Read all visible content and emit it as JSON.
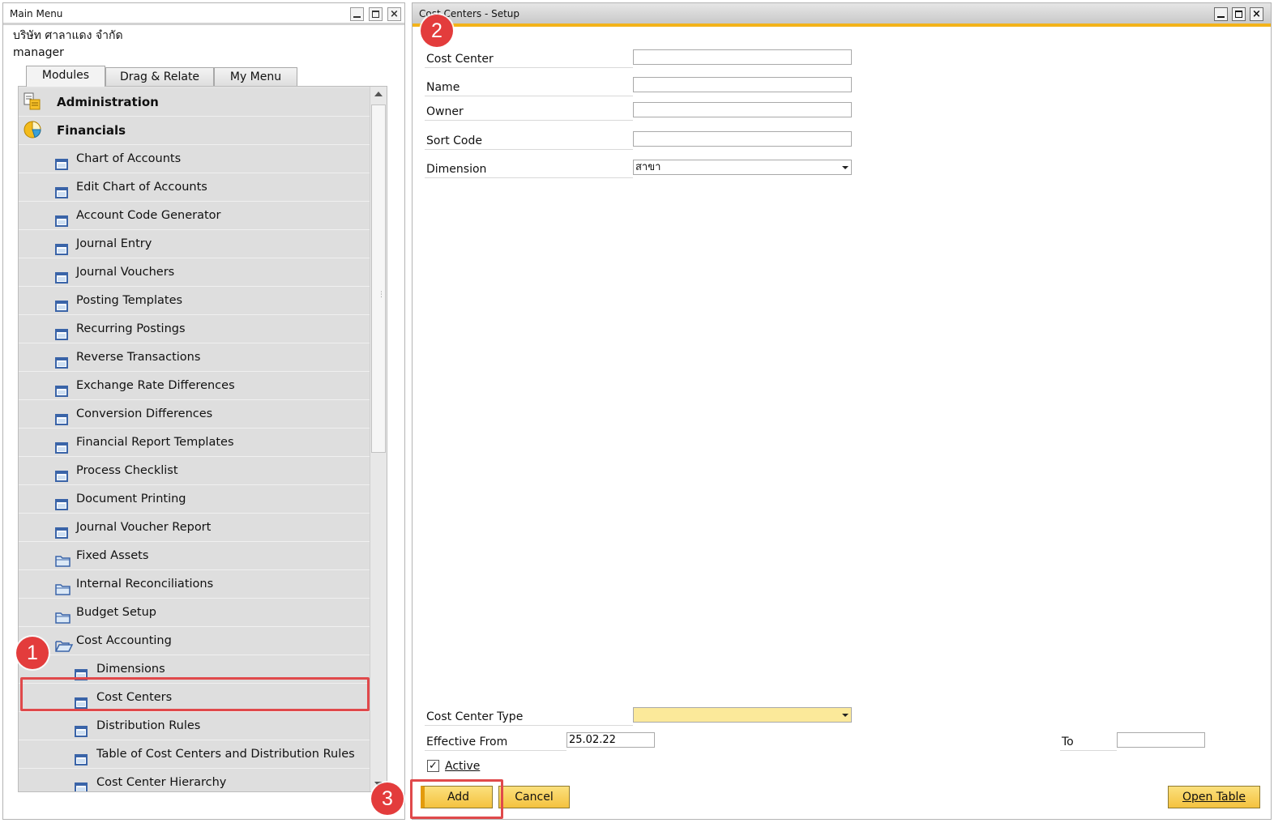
{
  "main_menu": {
    "title": "Main Menu",
    "company": "บริษัท ศาลาแดง จำกัด",
    "user": "manager",
    "tabs": [
      {
        "label": "Modules",
        "active": true
      },
      {
        "label": "Drag & Relate",
        "active": false
      },
      {
        "label": "My Menu",
        "active": false
      }
    ],
    "items": [
      {
        "label": "Administration",
        "level": 0,
        "icon": "administration-icon"
      },
      {
        "label": "Financials",
        "level": 0,
        "icon": "financials-icon"
      },
      {
        "label": "Chart of Accounts",
        "level": 1,
        "icon": "form-icon"
      },
      {
        "label": "Edit Chart of Accounts",
        "level": 1,
        "icon": "form-icon"
      },
      {
        "label": "Account Code Generator",
        "level": 1,
        "icon": "form-icon"
      },
      {
        "label": "Journal Entry",
        "level": 1,
        "icon": "form-icon"
      },
      {
        "label": "Journal Vouchers",
        "level": 1,
        "icon": "form-icon"
      },
      {
        "label": "Posting Templates",
        "level": 1,
        "icon": "form-icon"
      },
      {
        "label": "Recurring Postings",
        "level": 1,
        "icon": "form-icon"
      },
      {
        "label": "Reverse Transactions",
        "level": 1,
        "icon": "form-icon"
      },
      {
        "label": "Exchange Rate Differences",
        "level": 1,
        "icon": "form-icon"
      },
      {
        "label": "Conversion Differences",
        "level": 1,
        "icon": "form-icon"
      },
      {
        "label": "Financial Report Templates",
        "level": 1,
        "icon": "form-icon"
      },
      {
        "label": "Process Checklist",
        "level": 1,
        "icon": "form-icon"
      },
      {
        "label": "Document Printing",
        "level": 1,
        "icon": "form-icon"
      },
      {
        "label": "Journal Voucher Report",
        "level": 1,
        "icon": "form-icon"
      },
      {
        "label": "Fixed Assets",
        "level": 1,
        "icon": "folder-icon"
      },
      {
        "label": "Internal Reconciliations",
        "level": 1,
        "icon": "folder-icon"
      },
      {
        "label": "Budget Setup",
        "level": 1,
        "icon": "folder-icon"
      },
      {
        "label": "Cost Accounting",
        "level": 1,
        "icon": "open-folder-icon"
      },
      {
        "label": "Dimensions",
        "level": 2,
        "icon": "form-icon"
      },
      {
        "label": "Cost Centers",
        "level": 2,
        "icon": "form-icon"
      },
      {
        "label": "Distribution Rules",
        "level": 2,
        "icon": "form-icon"
      },
      {
        "label": "Table of Cost Centers and Distribution Rules",
        "level": 2,
        "icon": "form-icon"
      },
      {
        "label": "Cost Center Hierarchy",
        "level": 2,
        "icon": "form-icon"
      }
    ]
  },
  "cost_centers": {
    "title": "Cost Centers - Setup",
    "fields": {
      "cost_center": {
        "label": "Cost Center",
        "value": ""
      },
      "name": {
        "label": "Name",
        "value": ""
      },
      "owner": {
        "label": "Owner",
        "value": ""
      },
      "sort_code": {
        "label": "Sort Code",
        "value": ""
      },
      "dimension": {
        "label": "Dimension",
        "value": "สาขา"
      },
      "cost_center_type": {
        "label": "Cost Center Type",
        "value": ""
      },
      "effective_from": {
        "label": "Effective From",
        "value": "25.02.22"
      },
      "to": {
        "label": "To",
        "value": ""
      },
      "active": {
        "label": "Active",
        "checked": true
      }
    },
    "buttons": {
      "add": "Add",
      "cancel": "Cancel",
      "open_table": "Open Table"
    }
  },
  "callouts": [
    "1",
    "2",
    "3"
  ],
  "colors": {
    "accent_orange": "#f3b31a",
    "callout_red": "#e33c3c",
    "button_yellow": "#f4c23f",
    "menu_bg": "#dedede",
    "form_icon_blue": "#3a64a8"
  }
}
